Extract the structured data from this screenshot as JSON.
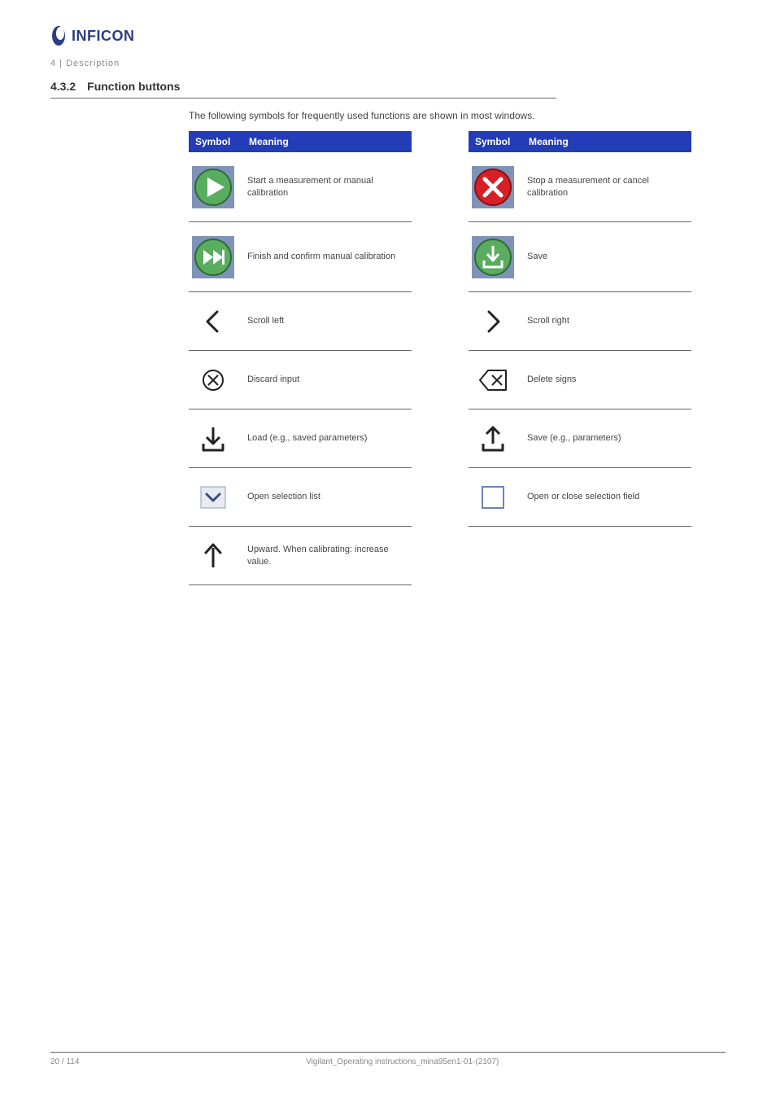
{
  "brand": "INFICON",
  "chapter_label": "4 | Description",
  "section": {
    "number": "4.3.2",
    "title": "Function buttons"
  },
  "intro": "The following symbols for frequently used functions are shown in most windows.",
  "tableHeaders": {
    "symbol": "Symbol",
    "meaning": "Meaning"
  },
  "left": [
    {
      "icon": "play",
      "meaning": "Start a measurement or manual calibration"
    },
    {
      "icon": "fastforward",
      "meaning": "Finish and confirm manual calibration"
    },
    {
      "icon": "chevron-left",
      "meaning": "Scroll left"
    },
    {
      "icon": "circle-x",
      "meaning": "Discard input"
    },
    {
      "icon": "download",
      "meaning": "Load (e.g., saved parameters)"
    },
    {
      "icon": "combobox",
      "meaning": "Open selection list"
    },
    {
      "icon": "arrow-up",
      "meaning": "Upward. When calibrating: increase value."
    }
  ],
  "right": [
    {
      "icon": "cancel-red",
      "meaning": "Stop a measurement or cancel calibration"
    },
    {
      "icon": "save-green",
      "meaning": "Save"
    },
    {
      "icon": "chevron-right",
      "meaning": "Scroll right"
    },
    {
      "icon": "backspace",
      "meaning": "Delete signs"
    },
    {
      "icon": "upload",
      "meaning": "Save (e.g., parameters)"
    },
    {
      "icon": "checkbox",
      "meaning": "Open or close selection field"
    }
  ],
  "footer": {
    "left": "20 / 114",
    "center": "Vigilant_Operating instructions_mina95en1-01-(2107)",
    "right": ""
  }
}
